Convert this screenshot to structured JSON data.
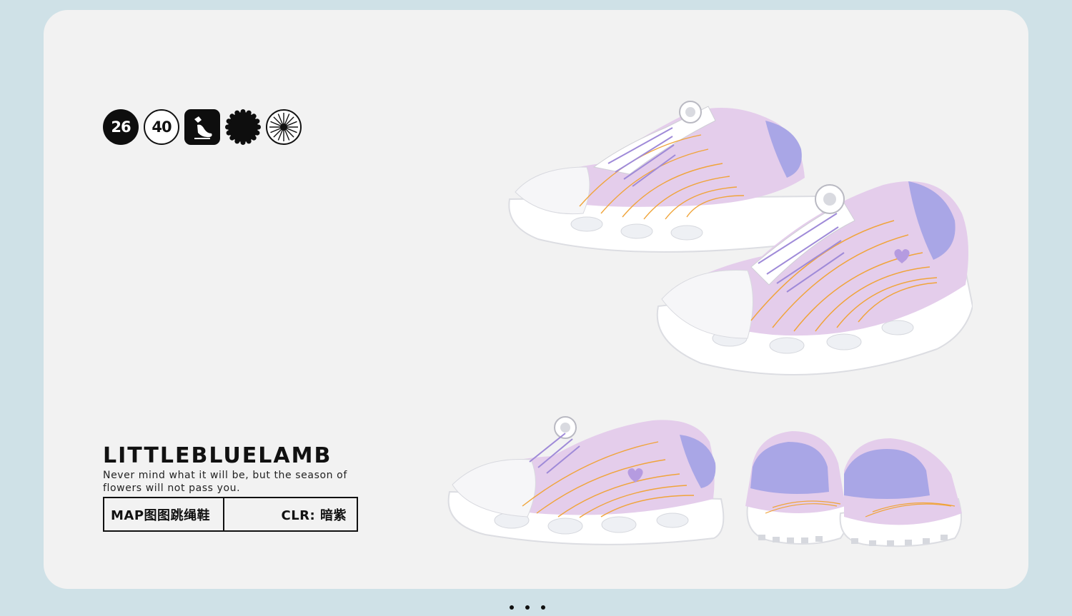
{
  "badges": [
    {
      "text": "26",
      "style": "black"
    },
    {
      "text": "40",
      "style": "outline"
    },
    {
      "icon": "shoe-stamp-icon",
      "style": "square"
    },
    {
      "icon": "flower-seal-icon",
      "style": "scallop"
    },
    {
      "icon": "starburst-icon",
      "style": "outline"
    }
  ],
  "brand": {
    "name": "LITTLEBLUELAMB",
    "tagline": "Never mind what it will be, but the season of flowers will not pass you."
  },
  "info": {
    "model": "MAP图图跳绳鞋",
    "color": "CLR: 暗紫"
  },
  "product_images": [
    {
      "icon": "sneaker-pair-image"
    },
    {
      "icon": "sneaker-side-image"
    },
    {
      "icon": "sneaker-heels-image"
    }
  ],
  "pagination": {
    "count": 3
  },
  "colors": {
    "background": "#cfe1e7",
    "card": "#f2f2f2",
    "mesh": "#e4cdeb",
    "heel": "#a9a6e6",
    "stitch": "#f0a43a",
    "sole": "#ffffff"
  }
}
